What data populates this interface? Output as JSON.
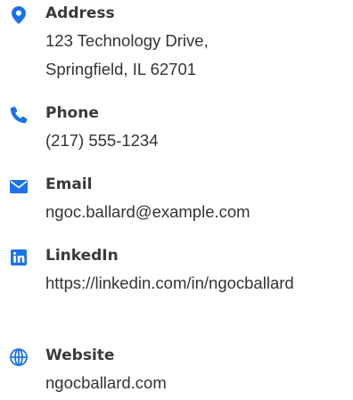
{
  "colors": {
    "accent": "#1a73e8",
    "label": "#3a3a3a",
    "text": "#333333"
  },
  "contacts": [
    {
      "icon": "map-pin-icon",
      "label": "Address",
      "lines": [
        "123 Technology Drive,",
        "Springfield, IL 62701"
      ]
    },
    {
      "icon": "phone-icon",
      "label": "Phone",
      "value": "(217) 555-1234"
    },
    {
      "icon": "envelope-icon",
      "label": "Email",
      "value": "ngoc.ballard@example.com"
    },
    {
      "icon": "linkedin-icon",
      "label": "LinkedIn",
      "value": "https://linkedin.com/in/ngocballard"
    },
    {
      "icon": "globe-icon",
      "label": "Website",
      "value": "ngocballard.com"
    }
  ]
}
